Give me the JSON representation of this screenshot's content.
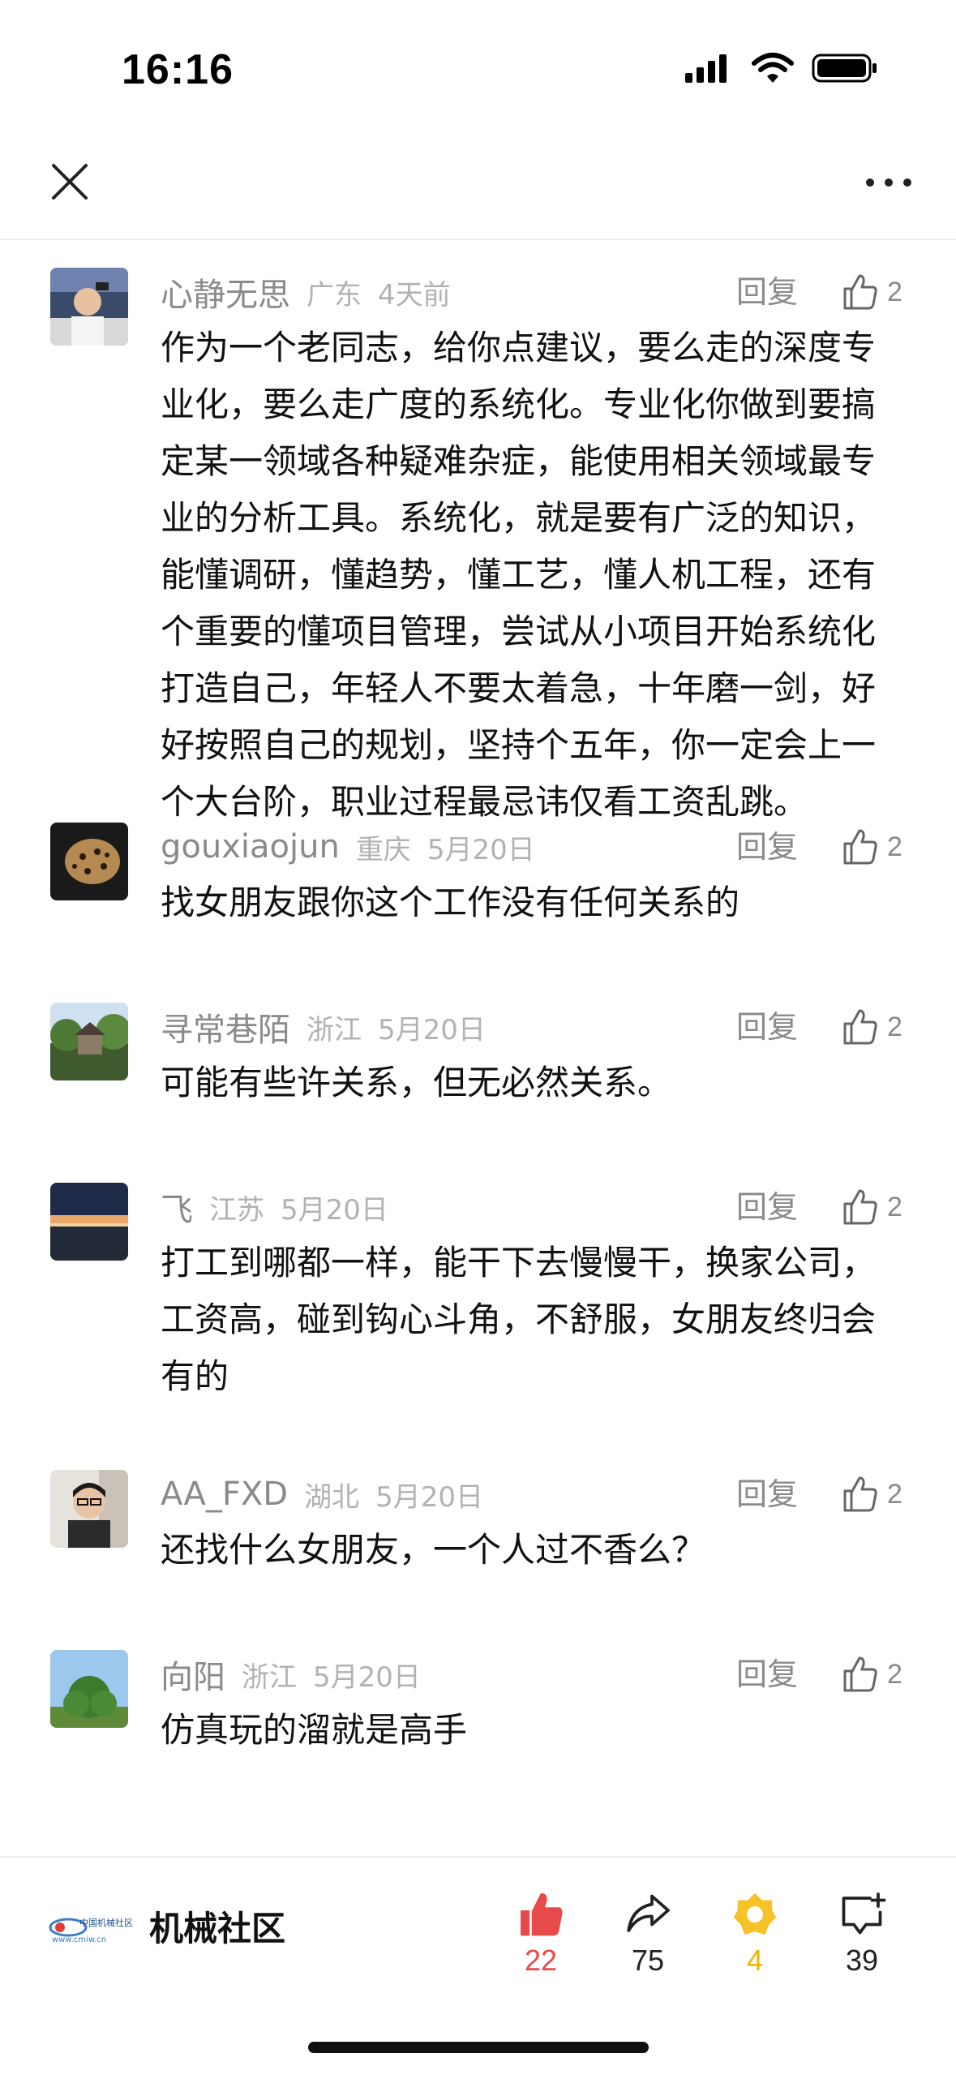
{
  "status_bar": {
    "time": "16:16"
  },
  "colors": {
    "like_active": "#e74a4a",
    "coin": "#f5c328",
    "meta_gray": "#8a8a8a"
  },
  "comments": [
    {
      "username": "心静无思",
      "location": "广东",
      "time": "4天前",
      "reply_label": "回复",
      "likes": "2",
      "text": "作为一个老同志，给你点建议，要么走的深度专业化，要么走广度的系统化。专业化你做到要搞定某一领域各种疑难杂症，能使用相关领域最专业的分析工具。系统化，就是要有广泛的知识，能懂调研，懂趋势，懂工艺，懂人机工程，还有个重要的懂项目管理，尝试从小项目开始系统化打造自己，年轻人不要太着急，十年磨一剑，好好按照自己的规划，坚持个五年，你一定会上一个大台阶，职业过程最忌讳仅看工资乱跳。"
    },
    {
      "username": "gouxiaojun",
      "location": "重庆",
      "time": "5月20日",
      "reply_label": "回复",
      "likes": "2",
      "text": "找女朋友跟你这个工作没有任何关系的"
    },
    {
      "username": "寻常巷陌",
      "location": "浙江",
      "time": "5月20日",
      "reply_label": "回复",
      "likes": "2",
      "text": "可能有些许关系，但无必然关系。"
    },
    {
      "username": "飞",
      "location": "江苏",
      "time": "5月20日",
      "reply_label": "回复",
      "likes": "2",
      "text": "打工到哪都一样，能干下去慢慢干，换家公司，工资高，碰到钩心斗角，不舒服，女朋友终归会有的"
    },
    {
      "username": "AA_FXD",
      "location": "湖北",
      "time": "5月20日",
      "reply_label": "回复",
      "likes": "2",
      "text": "还找什么女朋友，一个人过不香么？"
    },
    {
      "username": "向阳",
      "location": "浙江",
      "time": "5月20日",
      "reply_label": "回复",
      "likes": "2",
      "text": "仿真玩的溜就是高手"
    }
  ],
  "bottom_bar": {
    "community_name": "机械社区",
    "logo_text": "中国机械社区",
    "logo_url_text": "www.cmiw.cn",
    "like_count": "22",
    "share_count": "75",
    "coin_count": "4",
    "comment_count": "39"
  }
}
